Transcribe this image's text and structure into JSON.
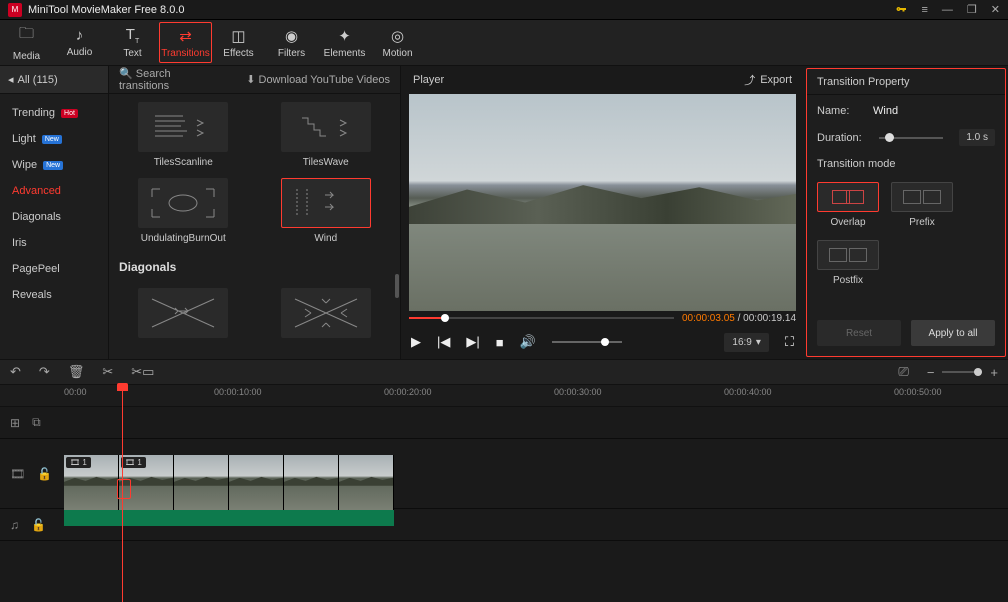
{
  "app": {
    "title": "MiniTool MovieMaker Free 8.0.0"
  },
  "toolbar": {
    "items": [
      {
        "label": "Media"
      },
      {
        "label": "Audio"
      },
      {
        "label": "Text"
      },
      {
        "label": "Transitions"
      },
      {
        "label": "Effects"
      },
      {
        "label": "Filters"
      },
      {
        "label": "Elements"
      },
      {
        "label": "Motion"
      }
    ]
  },
  "sidebar": {
    "header": "All (115)",
    "items": [
      {
        "label": "Trending",
        "badge": "Hot",
        "badgeType": "hot"
      },
      {
        "label": "Light",
        "badge": "New",
        "badgeType": "new"
      },
      {
        "label": "Wipe",
        "badge": "New",
        "badgeType": "new"
      },
      {
        "label": "Advanced"
      },
      {
        "label": "Diagonals"
      },
      {
        "label": "Iris"
      },
      {
        "label": "PagePeel"
      },
      {
        "label": "Reveals"
      }
    ]
  },
  "gallery": {
    "search": "Search transitions",
    "download": "Download YouTube Videos",
    "thumbs": [
      {
        "label": "TilesScanline"
      },
      {
        "label": "TilesWave"
      },
      {
        "label": "UndulatingBurnOut"
      },
      {
        "label": "Wind"
      }
    ],
    "cat2": "Diagonals"
  },
  "player": {
    "title": "Player",
    "export": "Export",
    "currentTime": "00:00:03.05",
    "totalTime": "00:00:19.14",
    "ratio": "16:9"
  },
  "props": {
    "title": "Transition Property",
    "nameLabel": "Name:",
    "nameValue": "Wind",
    "durationLabel": "Duration:",
    "durationValue": "1.0 s",
    "modeLabel": "Transition mode",
    "modes": [
      {
        "label": "Overlap"
      },
      {
        "label": "Prefix"
      },
      {
        "label": "Postfix"
      }
    ],
    "reset": "Reset",
    "apply": "Apply to all"
  },
  "timeline": {
    "marks": [
      "00:00",
      "00:00:10:00",
      "00:00:20:00",
      "00:00:30:00",
      "00:00:40:00",
      "00:00:50:00"
    ]
  }
}
